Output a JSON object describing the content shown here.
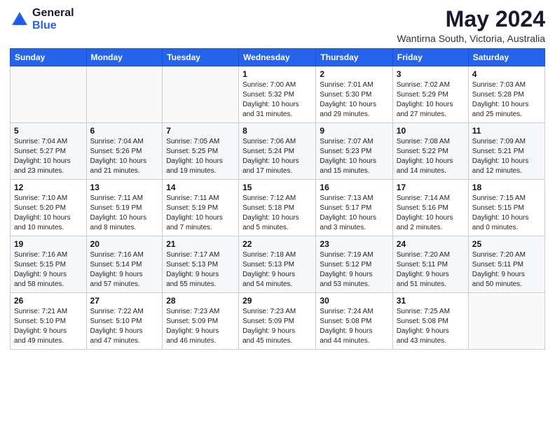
{
  "logo": {
    "general": "General",
    "blue": "Blue"
  },
  "header": {
    "month": "May 2024",
    "location": "Wantirna South, Victoria, Australia"
  },
  "weekdays": [
    "Sunday",
    "Monday",
    "Tuesday",
    "Wednesday",
    "Thursday",
    "Friday",
    "Saturday"
  ],
  "weeks": [
    [
      {
        "day": "",
        "info": ""
      },
      {
        "day": "",
        "info": ""
      },
      {
        "day": "",
        "info": ""
      },
      {
        "day": "1",
        "info": "Sunrise: 7:00 AM\nSunset: 5:32 PM\nDaylight: 10 hours\nand 31 minutes."
      },
      {
        "day": "2",
        "info": "Sunrise: 7:01 AM\nSunset: 5:30 PM\nDaylight: 10 hours\nand 29 minutes."
      },
      {
        "day": "3",
        "info": "Sunrise: 7:02 AM\nSunset: 5:29 PM\nDaylight: 10 hours\nand 27 minutes."
      },
      {
        "day": "4",
        "info": "Sunrise: 7:03 AM\nSunset: 5:28 PM\nDaylight: 10 hours\nand 25 minutes."
      }
    ],
    [
      {
        "day": "5",
        "info": "Sunrise: 7:04 AM\nSunset: 5:27 PM\nDaylight: 10 hours\nand 23 minutes."
      },
      {
        "day": "6",
        "info": "Sunrise: 7:04 AM\nSunset: 5:26 PM\nDaylight: 10 hours\nand 21 minutes."
      },
      {
        "day": "7",
        "info": "Sunrise: 7:05 AM\nSunset: 5:25 PM\nDaylight: 10 hours\nand 19 minutes."
      },
      {
        "day": "8",
        "info": "Sunrise: 7:06 AM\nSunset: 5:24 PM\nDaylight: 10 hours\nand 17 minutes."
      },
      {
        "day": "9",
        "info": "Sunrise: 7:07 AM\nSunset: 5:23 PM\nDaylight: 10 hours\nand 15 minutes."
      },
      {
        "day": "10",
        "info": "Sunrise: 7:08 AM\nSunset: 5:22 PM\nDaylight: 10 hours\nand 14 minutes."
      },
      {
        "day": "11",
        "info": "Sunrise: 7:09 AM\nSunset: 5:21 PM\nDaylight: 10 hours\nand 12 minutes."
      }
    ],
    [
      {
        "day": "12",
        "info": "Sunrise: 7:10 AM\nSunset: 5:20 PM\nDaylight: 10 hours\nand 10 minutes."
      },
      {
        "day": "13",
        "info": "Sunrise: 7:11 AM\nSunset: 5:19 PM\nDaylight: 10 hours\nand 8 minutes."
      },
      {
        "day": "14",
        "info": "Sunrise: 7:11 AM\nSunset: 5:19 PM\nDaylight: 10 hours\nand 7 minutes."
      },
      {
        "day": "15",
        "info": "Sunrise: 7:12 AM\nSunset: 5:18 PM\nDaylight: 10 hours\nand 5 minutes."
      },
      {
        "day": "16",
        "info": "Sunrise: 7:13 AM\nSunset: 5:17 PM\nDaylight: 10 hours\nand 3 minutes."
      },
      {
        "day": "17",
        "info": "Sunrise: 7:14 AM\nSunset: 5:16 PM\nDaylight: 10 hours\nand 2 minutes."
      },
      {
        "day": "18",
        "info": "Sunrise: 7:15 AM\nSunset: 5:15 PM\nDaylight: 10 hours\nand 0 minutes."
      }
    ],
    [
      {
        "day": "19",
        "info": "Sunrise: 7:16 AM\nSunset: 5:15 PM\nDaylight: 9 hours\nand 58 minutes."
      },
      {
        "day": "20",
        "info": "Sunrise: 7:16 AM\nSunset: 5:14 PM\nDaylight: 9 hours\nand 57 minutes."
      },
      {
        "day": "21",
        "info": "Sunrise: 7:17 AM\nSunset: 5:13 PM\nDaylight: 9 hours\nand 55 minutes."
      },
      {
        "day": "22",
        "info": "Sunrise: 7:18 AM\nSunset: 5:13 PM\nDaylight: 9 hours\nand 54 minutes."
      },
      {
        "day": "23",
        "info": "Sunrise: 7:19 AM\nSunset: 5:12 PM\nDaylight: 9 hours\nand 53 minutes."
      },
      {
        "day": "24",
        "info": "Sunrise: 7:20 AM\nSunset: 5:11 PM\nDaylight: 9 hours\nand 51 minutes."
      },
      {
        "day": "25",
        "info": "Sunrise: 7:20 AM\nSunset: 5:11 PM\nDaylight: 9 hours\nand 50 minutes."
      }
    ],
    [
      {
        "day": "26",
        "info": "Sunrise: 7:21 AM\nSunset: 5:10 PM\nDaylight: 9 hours\nand 49 minutes."
      },
      {
        "day": "27",
        "info": "Sunrise: 7:22 AM\nSunset: 5:10 PM\nDaylight: 9 hours\nand 47 minutes."
      },
      {
        "day": "28",
        "info": "Sunrise: 7:23 AM\nSunset: 5:09 PM\nDaylight: 9 hours\nand 46 minutes."
      },
      {
        "day": "29",
        "info": "Sunrise: 7:23 AM\nSunset: 5:09 PM\nDaylight: 9 hours\nand 45 minutes."
      },
      {
        "day": "30",
        "info": "Sunrise: 7:24 AM\nSunset: 5:08 PM\nDaylight: 9 hours\nand 44 minutes."
      },
      {
        "day": "31",
        "info": "Sunrise: 7:25 AM\nSunset: 5:08 PM\nDaylight: 9 hours\nand 43 minutes."
      },
      {
        "day": "",
        "info": ""
      }
    ]
  ]
}
